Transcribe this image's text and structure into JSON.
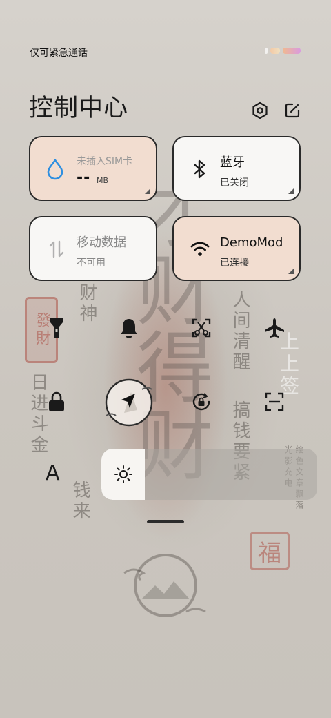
{
  "status_bar": {
    "carrier_text": "仅可紧急通话"
  },
  "header": {
    "title": "控制中心",
    "settings_icon": "hexagon-gear-icon",
    "edit_icon": "edit-icon"
  },
  "tiles": [
    {
      "title": "未插入SIM卡",
      "value": "--",
      "unit": "MB",
      "icon": "water-drop-icon",
      "bg": "#f2ddd0"
    },
    {
      "title": "蓝牙",
      "subtitle": "已关闭",
      "icon": "bluetooth-icon",
      "bg": "#f8f7f5"
    },
    {
      "title": "移动数据",
      "subtitle": "不可用",
      "icon": "data-arrows-icon",
      "bg": "#f8f7f5"
    },
    {
      "title": "DemoMod",
      "subtitle": "已连接",
      "icon": "wifi-icon",
      "bg": "#f2ddd0"
    }
  ],
  "quick_toggles": [
    {
      "name": "flashlight-icon"
    },
    {
      "name": "bell-icon"
    },
    {
      "name": "screenshot-icon"
    },
    {
      "name": "airplane-icon"
    },
    {
      "name": "lock-icon"
    },
    {
      "name": "location-icon"
    },
    {
      "name": "rotation-lock-icon"
    },
    {
      "name": "scan-icon"
    }
  ],
  "brightness": {
    "font_button": "A",
    "icon": "sun-icon",
    "level": 0.2
  },
  "wallpaper": {
    "text_cai_shen": "财神",
    "text_ri_jin": "日进斗金",
    "text_qian_lai": "钱来",
    "text_ren_jian": "人间清醒",
    "text_gao_qian": "搞钱要紧",
    "text_shang_shang": "上上签",
    "text_poem": "绘色文章飘落光影充电",
    "big_text": "才财得财",
    "seal_fu": "福",
    "seal_fa_cai": "發財"
  }
}
